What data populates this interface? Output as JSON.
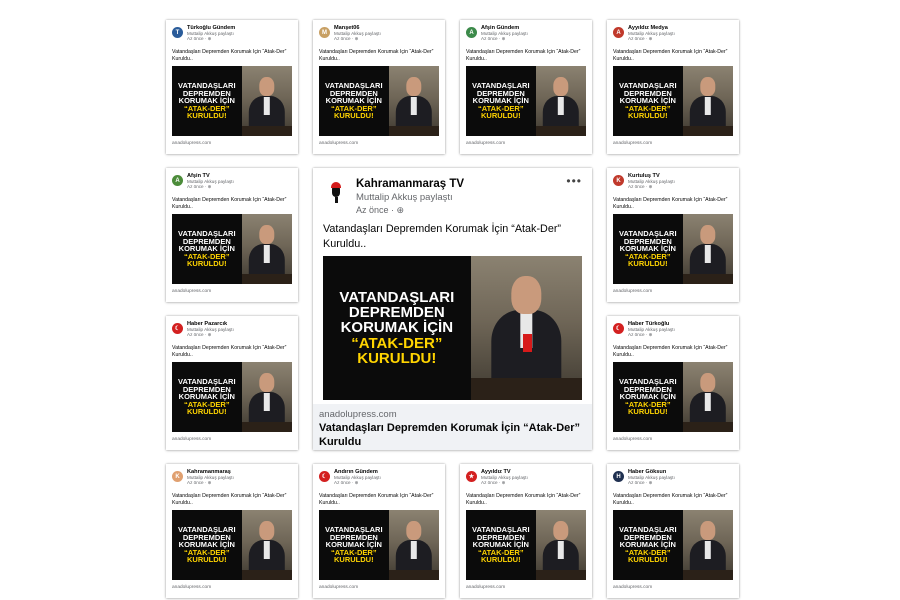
{
  "post": {
    "sharer": "Muttalip Akkuş paylaştı",
    "time": "Az önce · ⊕",
    "text": "Vatandaşları Depremden Korumak İçin “Atak-Der” Kuruldu..",
    "image_text": {
      "line1": "VATANDAŞLARI",
      "line2": "DEPREMDEN",
      "line3": "KORUMAK İÇİN",
      "line4": "“ATAK-DER”",
      "line5": "KURULDU!"
    },
    "link_domain": "anadolupress.com"
  },
  "featured": {
    "page_name": "Kahramanmaraş TV",
    "sharer": "Muttalip Akkuş paylaştı",
    "time": "Az önce · ⊕",
    "more": "•••",
    "text": "Vatandaşları Depremden Korumak İçin “Atak-Der” Kuruldu..",
    "link_domain": "anadolupress.com",
    "link_title": "Vatandaşları Depremden Korumak İçin “Atak-Der” Kuruldu"
  },
  "cards": [
    {
      "page_name": "Türkoğlu Gündem",
      "avatar_color": "#2a5c9a",
      "avatar_glyph": "T"
    },
    {
      "page_name": "Manşet06",
      "avatar_color": "#c8a064",
      "avatar_glyph": "M"
    },
    {
      "page_name": "Afşin Gündem",
      "avatar_color": "#3c8a4a",
      "avatar_glyph": "A"
    },
    {
      "page_name": "Ayyıldız Medya",
      "avatar_color": "#c0392b",
      "avatar_glyph": "A"
    },
    {
      "page_name": "Afşin TV",
      "avatar_color": "#4c8c3a",
      "avatar_glyph": "A"
    },
    {
      "page_name": "Kurtuluş TV",
      "avatar_color": "#c0392b",
      "avatar_glyph": "K"
    },
    {
      "page_name": "Haber Pazarcık",
      "avatar_color": "#d32020",
      "avatar_glyph": "☾"
    },
    {
      "page_name": "Haber Türkoğlu",
      "avatar_color": "#d32020",
      "avatar_glyph": "☾"
    },
    {
      "page_name": "Kahramanmaraş",
      "avatar_color": "#e0a070",
      "avatar_glyph": "K"
    },
    {
      "page_name": "Andırın Gündem",
      "avatar_color": "#d32020",
      "avatar_glyph": "☾"
    },
    {
      "page_name": "Ayyıldız TV",
      "avatar_color": "#d32020",
      "avatar_glyph": "★"
    },
    {
      "page_name": "Haber Göksun",
      "avatar_color": "#1f3050",
      "avatar_glyph": "H"
    }
  ],
  "colors": {
    "highlight": "#ffd400",
    "image_bg": "#0b0b0b",
    "meta_text": "#65676b"
  }
}
